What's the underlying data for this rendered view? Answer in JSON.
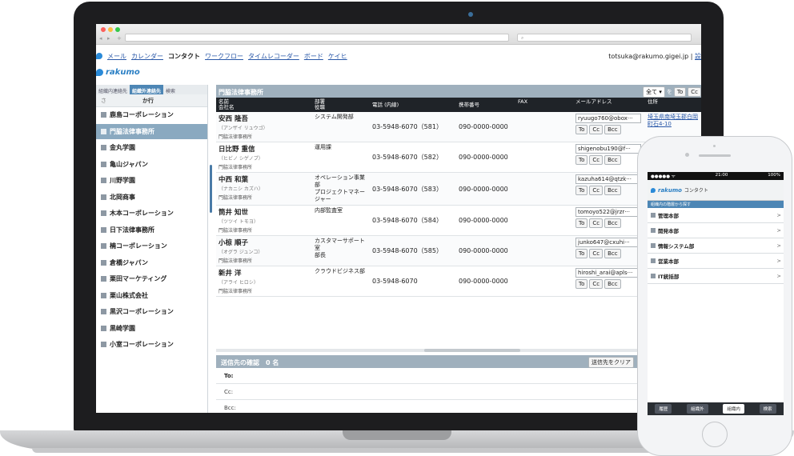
{
  "browser": {
    "back_label": "◂",
    "fwd_label": "▸",
    "new_tab_label": "+",
    "search_label": "⌕"
  },
  "appnav": {
    "items": [
      {
        "label": "メール",
        "current": false
      },
      {
        "label": "カレンダー",
        "current": false
      },
      {
        "label": "コンタクト",
        "current": true
      },
      {
        "label": "ワークフロー",
        "current": false
      },
      {
        "label": "タイムレコーダー",
        "current": false
      },
      {
        "label": "ボード",
        "current": false
      },
      {
        "label": "ケイヒ",
        "current": false
      }
    ],
    "user_email": "totsuka@rakumo.gigei.jp |",
    "user_link": "設"
  },
  "brand": {
    "name": "rakumo"
  },
  "left": {
    "tabs": [
      {
        "label": "組織内連絡先",
        "active": false
      },
      {
        "label": "組織外連絡先",
        "active": true
      },
      {
        "label": "検索",
        "active": false
      }
    ],
    "kana_prev": "さ",
    "kana_label": "か行",
    "orgs": [
      {
        "name": "鹿島コーポレーション",
        "selected": false
      },
      {
        "name": "門脇法律事務所",
        "selected": true
      },
      {
        "name": "金丸学園",
        "selected": false
      },
      {
        "name": "亀山ジャパン",
        "selected": false
      },
      {
        "name": "川野学園",
        "selected": false
      },
      {
        "name": "北岡商事",
        "selected": false
      },
      {
        "name": "木本コーポレーション",
        "selected": false
      },
      {
        "name": "日下法律事務所",
        "selected": false
      },
      {
        "name": "楠コーポレーション",
        "selected": false
      },
      {
        "name": "倉橋ジャパン",
        "selected": false
      },
      {
        "name": "栗田マーケティング",
        "selected": false
      },
      {
        "name": "栗山株式会社",
        "selected": false
      },
      {
        "name": "黒沢コーポレーション",
        "selected": false
      },
      {
        "name": "黒崎学園",
        "selected": false
      },
      {
        "name": "小室コーポレーション",
        "selected": false
      }
    ]
  },
  "right": {
    "title": "門脇法律事務所",
    "select_value": "全て",
    "wo_label": "を",
    "to_btn": "To",
    "cc_btn": "Cc",
    "headers": {
      "name": "名前",
      "company": "会社名",
      "dept": "部署",
      "role": "役職",
      "tel": "電話 (内線)",
      "mobile": "携帯番号",
      "fax": "FAX",
      "mail": "メールアドレス",
      "addr": "住所"
    },
    "contacts": [
      {
        "name": "安西 隆吾",
        "kana": "（アンザイ リュウゴ）",
        "org": "門脇法律事務所",
        "dept": "システム開発部",
        "tel": "03-5948-6070（581）",
        "mobile": "090-0000-0000",
        "mail": "ryuugo760@obox···",
        "addr": "埼玉県南埼玉郡白岡町石4-10"
      },
      {
        "name": "日比野 重信",
        "kana": "（ヒビノ シゲノブ）",
        "org": "門脇法律事務所",
        "dept": "運用課",
        "tel": "03-5948-6070（582）",
        "mobile": "090-0000-0000",
        "mail": "shigenobu190@f···",
        "addr": ""
      },
      {
        "name": "中西 和葉",
        "kana": "（ナカニシ カズハ）",
        "org": "門脇法律事務所",
        "dept": "オペレーション事業部\nプロジェクトマネージャー",
        "tel": "03-5948-6070（583）",
        "mobile": "090-0000-0000",
        "mail": "kazuha614@qtzk···",
        "addr": ""
      },
      {
        "name": "筒井 知世",
        "kana": "（ツツイ トモヨ）",
        "org": "門脇法律事務所",
        "dept": "内部監査室",
        "tel": "03-5948-6070（584）",
        "mobile": "090-0000-0000",
        "mail": "tomoyo522@jrzr···",
        "addr": ""
      },
      {
        "name": "小椋 順子",
        "kana": "（オグラ ジュンコ）",
        "org": "門脇法律事務所",
        "dept": "カスタマーサポート室\n部長",
        "tel": "03-5948-6070（585）",
        "mobile": "090-0000-0000",
        "mail": "junko647@cxuhi···",
        "addr": ""
      },
      {
        "name": "新井 洋",
        "kana": "（アライ ヒロシ）",
        "org": "門脇法律事務所",
        "dept": "クラウドビジネス部",
        "tel": "03-5948-6070",
        "mobile": "090-0000-0000",
        "mail": "hiroshi_arai@apls···",
        "addr": ""
      }
    ],
    "btn_to": "To",
    "btn_cc": "Cc",
    "btn_bcc": "Bcc",
    "confirm_title": "送信先の確認　0 名",
    "clear_label": "送信先をクリア",
    "to_label": "To:",
    "cc_label": "Cc:",
    "bcc_label": "Bcc:"
  },
  "phone": {
    "time": "21:00",
    "battery": "100%",
    "carrier": "●●●●● ᯤ",
    "brand": "rakumo",
    "app": "コンタクト",
    "subtitle": "組織内の階層から探す",
    "items": [
      "管理本部",
      "開発本部",
      "情報システム部",
      "営業本部",
      "IT統括部"
    ],
    "chev": ">",
    "tabs": [
      {
        "label": "履歴",
        "active": false
      },
      {
        "label": "組織外",
        "active": false
      },
      {
        "label": "組織内",
        "active": true
      },
      {
        "label": "検索",
        "active": false
      }
    ]
  }
}
